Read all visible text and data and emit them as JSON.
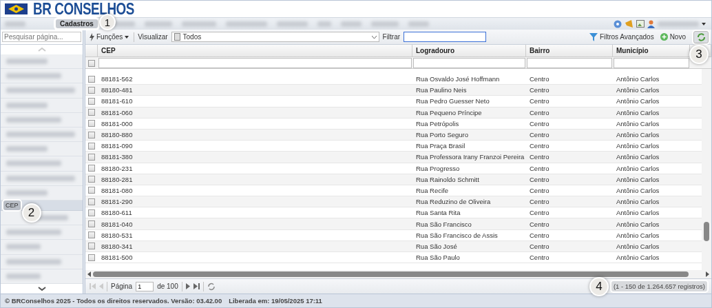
{
  "app": {
    "logo_text": "BR CONSELHOS"
  },
  "menu": {
    "items": [
      {
        "label": "Cadastros",
        "selected": true,
        "callout": "1"
      }
    ]
  },
  "sidebar": {
    "search": {
      "placeholder": "Pesquisar página..."
    },
    "items": [
      {
        "label": "CEP",
        "selected": true,
        "callout": "2"
      }
    ]
  },
  "toolbar": {
    "functions": "Funções",
    "view_label": "Visualizar",
    "view_value": "Todos",
    "filter_label": "Filtrar",
    "advanced": "Filtros Avançados",
    "new": "Novo",
    "refresh_callout": "3"
  },
  "table": {
    "select_all_checked": false,
    "columns": [
      "CEP",
      "Logradouro",
      "Bairro",
      "Município"
    ],
    "rows": [
      {
        "cep": "88181-562",
        "logradouro": "Rua Osvaldo José Hoffmann",
        "bairro": "Centro",
        "municipio": "Antônio Carlos",
        "checked": false
      },
      {
        "cep": "88180-481",
        "logradouro": "Rua Paulino Neis",
        "bairro": "Centro",
        "municipio": "Antônio Carlos",
        "checked": false
      },
      {
        "cep": "88181-610",
        "logradouro": "Rua Pedro Guesser Neto",
        "bairro": "Centro",
        "municipio": "Antônio Carlos",
        "checked": false
      },
      {
        "cep": "88181-060",
        "logradouro": "Rua Pequeno Príncipe",
        "bairro": "Centro",
        "municipio": "Antônio Carlos",
        "checked": false
      },
      {
        "cep": "88181-000",
        "logradouro": "Rua Petrópolis",
        "bairro": "Centro",
        "municipio": "Antônio Carlos",
        "checked": false
      },
      {
        "cep": "88180-880",
        "logradouro": "Rua Porto Seguro",
        "bairro": "Centro",
        "municipio": "Antônio Carlos",
        "checked": false
      },
      {
        "cep": "88181-090",
        "logradouro": "Rua Praça Brasil",
        "bairro": "Centro",
        "municipio": "Antônio Carlos",
        "checked": false
      },
      {
        "cep": "88181-380",
        "logradouro": "Rua Professora Irany Franzoi Pereira",
        "bairro": "Centro",
        "municipio": "Antônio Carlos",
        "checked": false
      },
      {
        "cep": "88180-231",
        "logradouro": "Rua Progresso",
        "bairro": "Centro",
        "municipio": "Antônio Carlos",
        "checked": false
      },
      {
        "cep": "88180-281",
        "logradouro": "Rua Rainoldo Schmitt",
        "bairro": "Centro",
        "municipio": "Antônio Carlos",
        "checked": false
      },
      {
        "cep": "88181-080",
        "logradouro": "Rua Recife",
        "bairro": "Centro",
        "municipio": "Antônio Carlos",
        "checked": false
      },
      {
        "cep": "88181-290",
        "logradouro": "Rua Reduzino de Oliveira",
        "bairro": "Centro",
        "municipio": "Antônio Carlos",
        "checked": false
      },
      {
        "cep": "88180-611",
        "logradouro": "Rua Santa Rita",
        "bairro": "Centro",
        "municipio": "Antônio Carlos",
        "checked": false
      },
      {
        "cep": "88181-040",
        "logradouro": "Rua São Francisco",
        "bairro": "Centro",
        "municipio": "Antônio Carlos",
        "checked": false
      },
      {
        "cep": "88180-531",
        "logradouro": "Rua São Francisco de Assis",
        "bairro": "Centro",
        "municipio": "Antônio Carlos",
        "checked": false
      },
      {
        "cep": "88180-341",
        "logradouro": "Rua São José",
        "bairro": "Centro",
        "municipio": "Antônio Carlos",
        "checked": false
      },
      {
        "cep": "88181-500",
        "logradouro": "Rua São Paulo",
        "bairro": "Centro",
        "municipio": "Antônio Carlos",
        "checked": false
      }
    ]
  },
  "pager": {
    "page_label": "Página",
    "page": "1",
    "of": "de 100",
    "records": "(1 - 150 de 1.264.657 registros)",
    "records_callout": "4"
  },
  "footer": {
    "copyright": "© BRConselhos 2025 - Todos os direitos reservados. Versão: 03.42.00",
    "released": "Liberada em: 19/05/2025 17:11"
  }
}
